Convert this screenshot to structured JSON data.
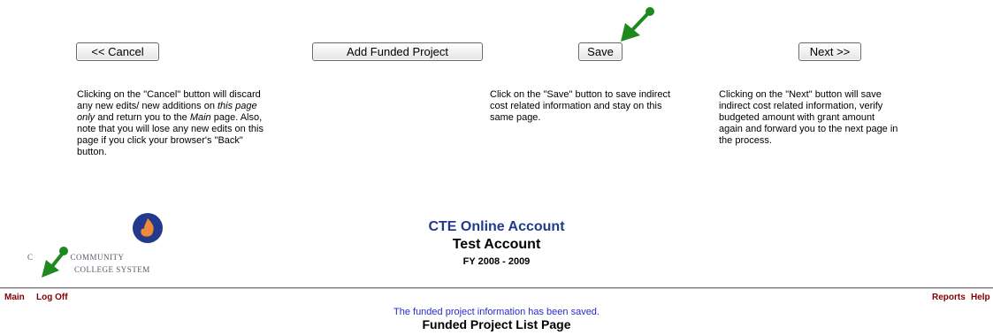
{
  "buttons": {
    "cancel": "<< Cancel",
    "add_funded_project": "Add Funded Project",
    "save": "Save",
    "next": "Next >>"
  },
  "descriptions": {
    "cancel": {
      "l1": "Clicking on the \"Cancel\" button will discard",
      "l2": "any new edits/ new additions on ",
      "l2_em": "this page",
      "l3_em": "only",
      "l3": " and return you to the ",
      "l3_em2": "Main",
      "l3_end": " page. Also,",
      "l4": "note that you will lose any new edits on this",
      "l5": "page if you click your browser's \"Back\"",
      "l6": "button."
    },
    "save": {
      "l1": "Click on the \"Save\" button to save indirect",
      "l2": "cost related information and stay on this",
      "l3": "same page."
    },
    "next": {
      "l1": "Clicking on the \"Next\" button will save",
      "l2": "indirect cost related information, verify",
      "l3": "budgeted amount with grant amount",
      "l4": "again and forward you to the next page in",
      "l5": "the process."
    }
  },
  "logo": {
    "line1_a": "C",
    "line1_b": "COMMUNITY",
    "line2": "COLLEGE SYSTEM"
  },
  "header": {
    "title": "CTE Online Account",
    "subtitle": "Test Account",
    "fiscal_year": "FY 2008 - 2009"
  },
  "nav": {
    "main": "Main",
    "logoff": "Log Off",
    "reports": "Reports",
    "help": "Help"
  },
  "status_message": "The funded project information has been saved.",
  "page_title": "Funded Project List Page",
  "colors": {
    "arrow": "#1e8a1e",
    "nav_link": "#800000",
    "status": "#2a2ad0",
    "logo_circle": "#233a8c",
    "logo_flame": "#f08a3a"
  }
}
